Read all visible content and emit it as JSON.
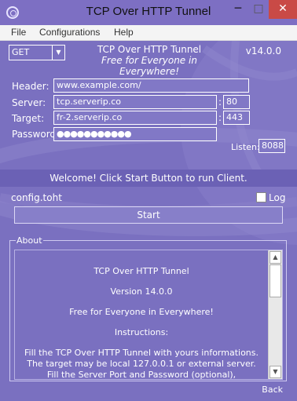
{
  "window": {
    "title": "TCP Over HTTP Tunnel",
    "minimize": "─",
    "maximize": "□",
    "close": "✕"
  },
  "menu": [
    "File",
    "Configurations",
    "Help"
  ],
  "header": {
    "method": "GET",
    "app_name": "TCP Over HTTP Tunnel",
    "tagline": "Free for Everyone in Everywhere!",
    "version": "v14.0.0"
  },
  "form": {
    "header_label": "Header:",
    "header_value": "www.example.com/",
    "server_label": "Server:",
    "server_value": "tcp.serverip.co",
    "server_port": "80",
    "target_label": "Target:",
    "target_value": "fr-2.serverip.co",
    "target_port": "443",
    "password_label": "Password:",
    "password_value": "●●●●●●●●●●●",
    "listen_label": "Listen:",
    "listen_port": "8088"
  },
  "status": "Welcome! Click Start Button to run Client.",
  "config_name": "config.toht",
  "log_label": "Log",
  "start_label": "Start",
  "about": {
    "legend": "About",
    "lines": [
      "TCP Over HTTP Tunnel",
      "Version 14.0.0",
      "Free for Everyone in Everywhere!",
      "Instructions:",
      "Fill the TCP Over HTTP Tunnel with yours informations.",
      "The target may be local 127.0.0.1 or external server.",
      "Fill the Server Port and Password (optional),"
    ],
    "back": "Back"
  }
}
